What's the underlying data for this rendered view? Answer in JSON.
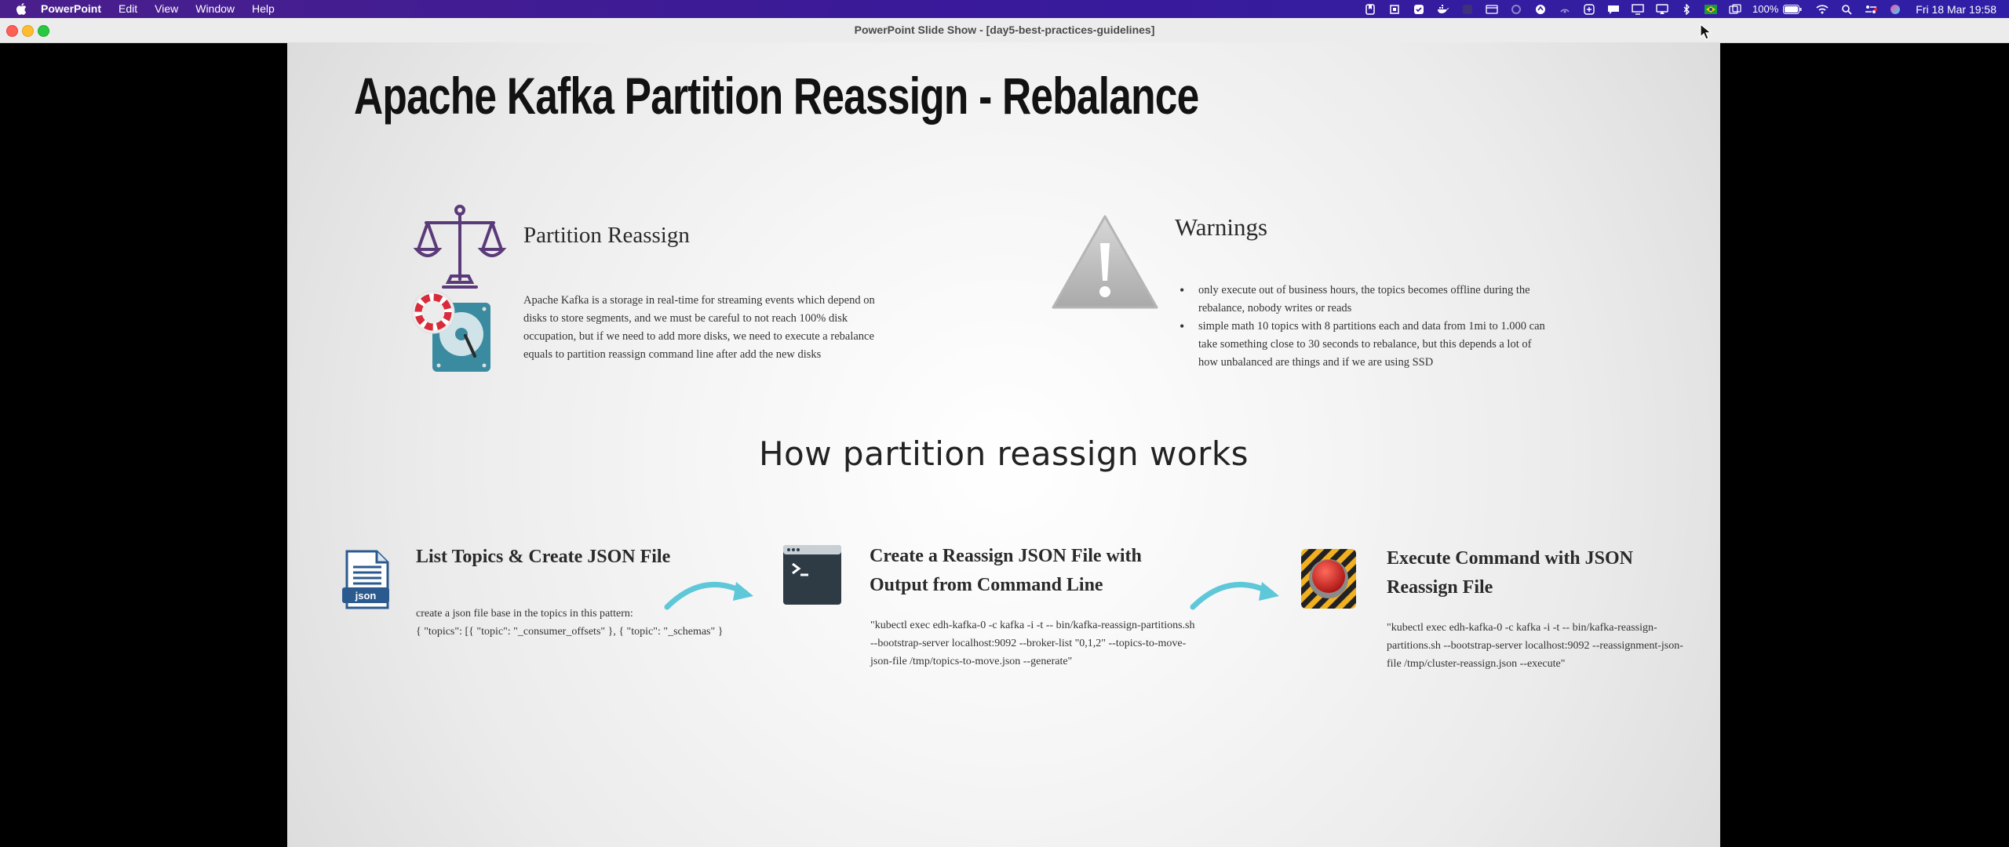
{
  "menubar": {
    "apple_icon": "apple-logo-icon",
    "items": [
      "PowerPoint",
      "Edit",
      "View",
      "Window",
      "Help"
    ],
    "battery_percent": "100%",
    "clock": "Fri 18 Mar  19:58"
  },
  "window": {
    "title": "PowerPoint Slide Show - [day5-best-practices-guidelines]"
  },
  "slide": {
    "title": "Apache Kafka Partition Reassign - Rebalance",
    "partition_reassign": {
      "heading": "Partition Reassign",
      "body": "Apache Kafka is a storage in real-time for streaming events which depend on disks to store segments, and we must be careful to not reach 100% disk occupation, but if we need to add more disks, we need to execute a rebalance equals to partition reassign command line after add the new disks",
      "icons": [
        "balance-scale-icon",
        "hard-disk-icon",
        "lifebuoy-icon"
      ]
    },
    "warnings": {
      "heading": "Warnings",
      "icon": "warning-triangle-icon",
      "items": [
        "only execute out of business hours, the topics becomes offline during the rebalance, nobody writes or reads",
        "simple math 10 topics with 8 partitions each and data from 1mi to 1.000 can take something close to 30 seconds to rebalance, but this depends a lot of how unbalanced are things and if we are using SSD"
      ]
    },
    "how_heading": "How partition reassign works",
    "steps": [
      {
        "heading": "List Topics & Create JSON File",
        "icon": "json-file-icon",
        "icon_label": "json",
        "body_lines": [
          "create a json file base in the topics in this pattern:",
          "{ \"topics\": [{ \"topic\": \"_consumer_offsets\" }, { \"topic\": \"_schemas\" }"
        ]
      },
      {
        "heading": "Create a Reassign JSON File with Output from Command Line",
        "icon": "terminal-icon",
        "body": "\"kubectl exec edh-kafka-0 -c kafka -i -t -- bin/kafka-reassign-partitions.sh --bootstrap-server localhost:9092 --broker-list \"0,1,2\" --topics-to-move-json-file /tmp/topics-to-move.json --generate\""
      },
      {
        "heading": "Execute Command with JSON Reassign File",
        "icon": "red-button-icon",
        "body": "\"kubectl exec edh-kafka-0 -c kafka -i -t -- bin/kafka-reassign-partitions.sh --bootstrap-server localhost:9092 --reassignment-json-file /tmp/cluster-reassign.json --execute\""
      }
    ]
  },
  "colors": {
    "menubar_start": "#4a1f8c",
    "menubar_end": "#2f1fa6",
    "scale_purple": "#5b3a7a",
    "disk_teal": "#3a8aa0",
    "json_blue": "#2b5a8f",
    "terminal_dark": "#2e3a44",
    "arrow_teal": "#5ec7d8",
    "stop_red": "#cc1f1f",
    "hazard_yellow": "#f0b020"
  }
}
